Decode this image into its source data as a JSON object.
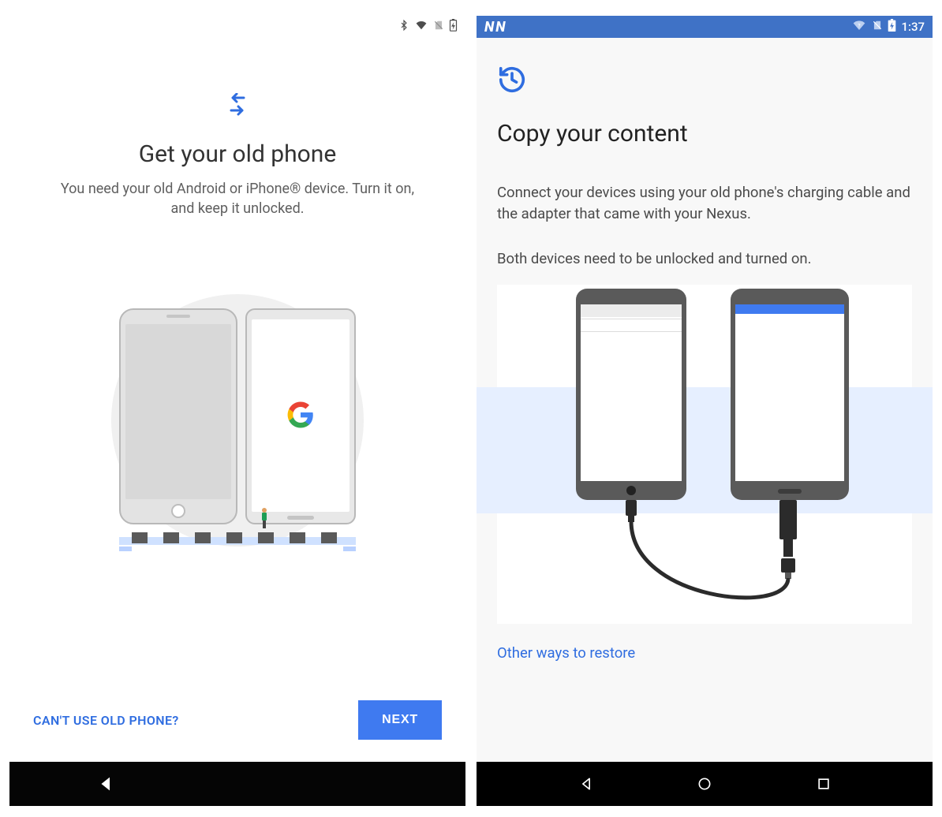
{
  "screen1": {
    "status": {
      "bluetooth_icon": "bluetooth-icon",
      "wifi_icon": "wifi-icon",
      "nosim_icon": "no-sim-icon",
      "battery_icon": "battery-charging-icon"
    },
    "title": "Get your old phone",
    "body": "You need your old Android or iPhone® device. Turn it on, and keep it unlocked.",
    "alt_link": "CAN'T USE OLD PHONE?",
    "next_button": "NEXT",
    "nav": {
      "back_icon": "nav-back-icon"
    }
  },
  "screen2": {
    "status": {
      "n_logo": "N",
      "wifi_unknown_icon": "wifi-unknown-icon",
      "nosim_icon": "no-sim-icon",
      "battery_icon": "battery-charging-icon",
      "time": "1:37"
    },
    "restore_icon": "restore-icon",
    "title": "Copy your content",
    "body1": "Connect your devices using your old phone's charging cable and the adapter that came with your Nexus.",
    "body2": "Both devices need to be unlocked and turned on.",
    "other_ways_link": "Other ways to restore",
    "nav": {
      "back_icon": "nav-back-icon",
      "home_icon": "nav-home-icon",
      "recent_icon": "nav-recent-icon"
    }
  }
}
